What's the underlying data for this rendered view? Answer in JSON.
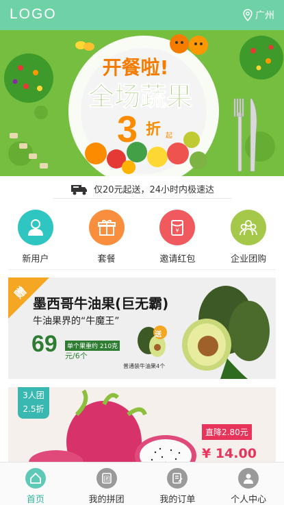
{
  "header": {
    "logo": "LOGO",
    "city": "广州",
    "location_icon": "location-pin-icon"
  },
  "banner": {
    "headline_small": "开餐啦!",
    "headline_main": "全场蔬果",
    "discount_number": "3",
    "discount_text": "折",
    "discount_suffix": "起"
  },
  "notice": {
    "icon": "delivery-truck-icon",
    "text": "仅20元起送，24小时内极速达"
  },
  "menu": {
    "items": [
      {
        "label": "新用户",
        "icon": "user-icon",
        "color": "#2fc6c2"
      },
      {
        "label": "套餐",
        "icon": "gift-icon",
        "color": "#f98f3e"
      },
      {
        "label": "邀请红包",
        "icon": "red-packet-icon",
        "color": "#f05a5e"
      },
      {
        "label": "企业团购",
        "icon": "group-icon",
        "color": "#a6c84a"
      }
    ]
  },
  "products": [
    {
      "badge": "赠",
      "title": "墨西哥牛油果(巨无霸)",
      "subtitle": "牛油果界的“牛魔王”",
      "price": "69",
      "unit": "元/6个",
      "weight": "单个果重约 210克",
      "gift_tag": "送",
      "gift_note": "普通装牛油果4个"
    },
    {
      "group_tag_line1": "3人团",
      "group_tag_line2": "2.5折",
      "discount_label": "直降2.80元",
      "price": "¥ 14.00"
    }
  ],
  "tabbar": {
    "tabs": [
      {
        "label": "首页",
        "icon": "home-icon",
        "active": true
      },
      {
        "label": "我的拼团",
        "icon": "group-buy-icon",
        "active": false
      },
      {
        "label": "我的订单",
        "icon": "order-icon",
        "active": false
      },
      {
        "label": "个人中心",
        "icon": "profile-icon",
        "active": false
      }
    ]
  },
  "colors": {
    "header": "#6fd1a6",
    "active_tab": "#2fb29c",
    "price_green": "#2e7d32",
    "price_red": "#e8345b"
  }
}
